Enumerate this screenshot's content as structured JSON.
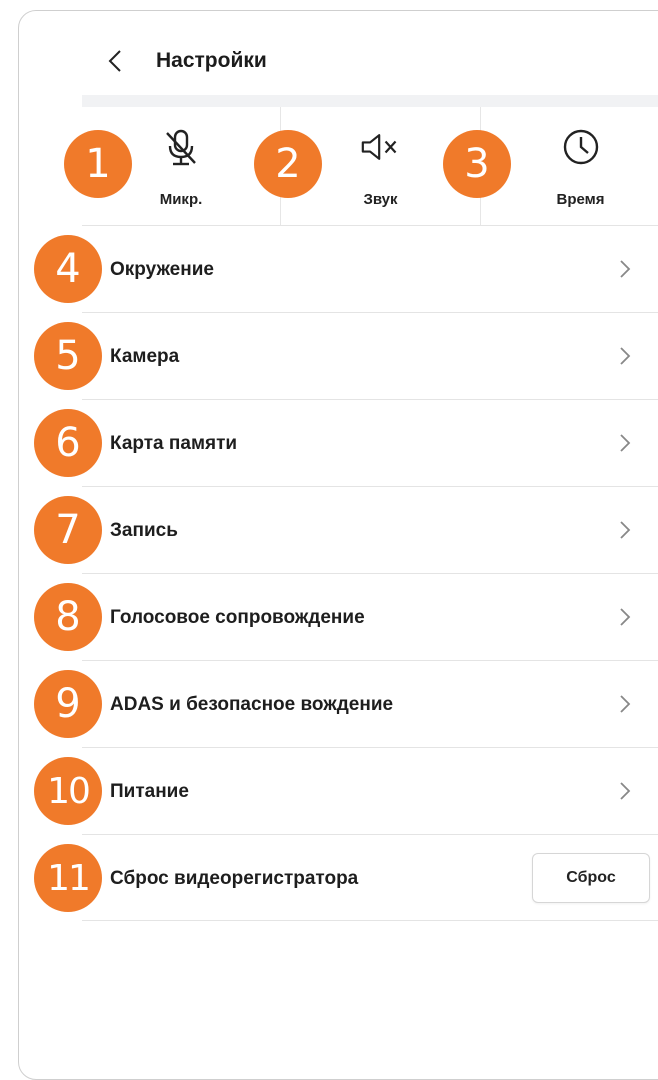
{
  "header": {
    "title": "Настройки",
    "back_icon": "chevron-left-icon"
  },
  "quick_settings": [
    {
      "label": "Микр.",
      "icon": "mic-off-icon"
    },
    {
      "label": "Звук",
      "icon": "volume-mute-icon"
    },
    {
      "label": "Время",
      "icon": "clock-icon"
    }
  ],
  "menu": [
    {
      "label": "Окружение"
    },
    {
      "label": "Камера"
    },
    {
      "label": "Карта памяти"
    },
    {
      "label": "Запись"
    },
    {
      "label": "Голосовое сопровождение"
    },
    {
      "label": "ADAS и безопасное вождение"
    },
    {
      "label": "Питание"
    }
  ],
  "reset": {
    "label": "Сброс видеорегистратора",
    "button_label": "Сброс"
  },
  "callouts": [
    "1",
    "2",
    "3",
    "4",
    "5",
    "6",
    "7",
    "8",
    "9",
    "10",
    "11"
  ],
  "colors": {
    "callout": "#f07a2a",
    "text": "#1e1e1e",
    "divider": "#e4e4e4"
  }
}
